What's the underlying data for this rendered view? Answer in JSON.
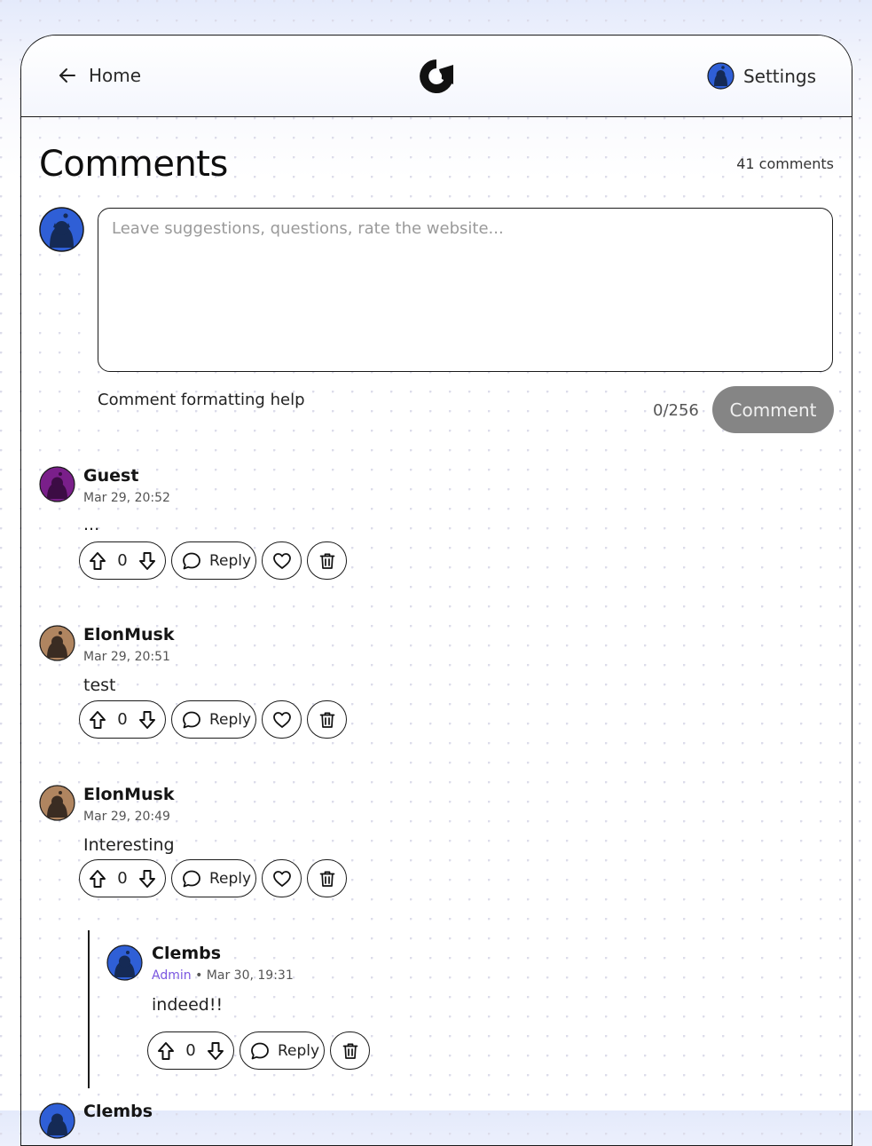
{
  "header": {
    "home_label": "Home",
    "settings_label": "Settings"
  },
  "page": {
    "title": "Comments",
    "count_label": "41 comments"
  },
  "composer": {
    "placeholder": "Leave suggestions, questions, rate the website...",
    "help_label": "Comment formatting help",
    "char_count": "0/256",
    "submit_label": "Comment"
  },
  "comments": [
    {
      "author": "Guest",
      "role": "",
      "timestamp": "Mar 29, 20:52",
      "body": "...",
      "votes": "0",
      "reply_label": "Reply",
      "avatar_color": "#6b1b7a"
    },
    {
      "author": "ElonMusk",
      "role": "",
      "timestamp": "Mar 29, 20:51",
      "body": "test",
      "votes": "0",
      "reply_label": "Reply",
      "avatar_color": "#8a6a4a"
    },
    {
      "author": "ElonMusk",
      "role": "",
      "timestamp": "Mar 29, 20:49",
      "body": "Interesting",
      "votes": "0",
      "reply_label": "Reply",
      "avatar_color": "#8a6a4a"
    },
    {
      "author": "Clembs",
      "role": "Admin",
      "timestamp": "Mar 30, 19:31",
      "body": "indeed!!",
      "votes": "0",
      "reply_label": "Reply",
      "avatar_color": "#2f5fd6",
      "meta_sep": " • "
    },
    {
      "author": "Clembs"
    }
  ],
  "colors": {
    "accent_admin": "#7a56e0",
    "button_disabled": "#858585"
  }
}
